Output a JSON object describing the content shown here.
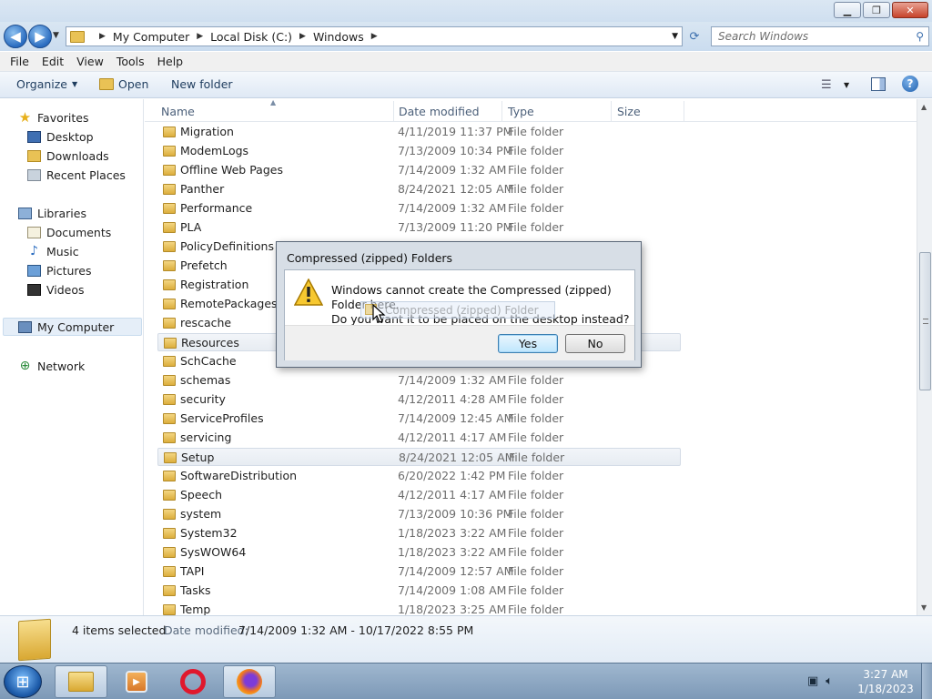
{
  "window": {
    "minimize": "▁",
    "maximize": "❐",
    "close": "✕"
  },
  "address": {
    "back": "◀",
    "forward": "▶",
    "crumbs": [
      "My Computer",
      "Local Disk (C:)",
      "Windows"
    ],
    "search_placeholder": "Search Windows"
  },
  "menu": [
    "File",
    "Edit",
    "View",
    "Tools",
    "Help"
  ],
  "toolbar": {
    "organize": "Organize",
    "open": "Open",
    "new_folder": "New folder",
    "help": "?"
  },
  "nav": {
    "favorites": "Favorites",
    "desktop": "Desktop",
    "downloads": "Downloads",
    "recent": "Recent Places",
    "libraries": "Libraries",
    "documents": "Documents",
    "music": "Music",
    "pictures": "Pictures",
    "videos": "Videos",
    "computer": "My Computer",
    "network": "Network"
  },
  "columns": {
    "name": "Name",
    "date": "Date modified",
    "type": "Type",
    "size": "Size"
  },
  "files": [
    {
      "name": "Migration",
      "date": "4/11/2019 11:37 PM",
      "type": "File folder"
    },
    {
      "name": "ModemLogs",
      "date": "7/13/2009 10:34 PM",
      "type": "File folder"
    },
    {
      "name": "Offline Web Pages",
      "date": "7/14/2009 1:32 AM",
      "type": "File folder"
    },
    {
      "name": "Panther",
      "date": "8/24/2021 12:05 AM",
      "type": "File folder"
    },
    {
      "name": "Performance",
      "date": "7/14/2009 1:32 AM",
      "type": "File folder"
    },
    {
      "name": "PLA",
      "date": "7/13/2009 11:20 PM",
      "type": "File folder"
    },
    {
      "name": "PolicyDefinitions",
      "date": "",
      "type": ""
    },
    {
      "name": "Prefetch",
      "date": "",
      "type": ""
    },
    {
      "name": "Registration",
      "date": "",
      "type": ""
    },
    {
      "name": "RemotePackages",
      "date": "",
      "type": ""
    },
    {
      "name": "rescache",
      "date": "",
      "type": ""
    },
    {
      "name": "Resources",
      "date": "",
      "type": ""
    },
    {
      "name": "SchCache",
      "date": "",
      "type": ""
    },
    {
      "name": "schemas",
      "date": "7/14/2009 1:32 AM",
      "type": "File folder"
    },
    {
      "name": "security",
      "date": "4/12/2011 4:28 AM",
      "type": "File folder"
    },
    {
      "name": "ServiceProfiles",
      "date": "7/14/2009 12:45 AM",
      "type": "File folder"
    },
    {
      "name": "servicing",
      "date": "4/12/2011 4:17 AM",
      "type": "File folder"
    },
    {
      "name": "Setup",
      "date": "8/24/2021 12:05 AM",
      "type": "File folder"
    },
    {
      "name": "SoftwareDistribution",
      "date": "6/20/2022 1:42 PM",
      "type": "File folder"
    },
    {
      "name": "Speech",
      "date": "4/12/2011 4:17 AM",
      "type": "File folder"
    },
    {
      "name": "system",
      "date": "7/13/2009 10:36 PM",
      "type": "File folder"
    },
    {
      "name": "System32",
      "date": "1/18/2023 3:22 AM",
      "type": "File folder"
    },
    {
      "name": "SysWOW64",
      "date": "1/18/2023 3:22 AM",
      "type": "File folder"
    },
    {
      "name": "TAPI",
      "date": "7/14/2009 12:57 AM",
      "type": "File folder"
    },
    {
      "name": "Tasks",
      "date": "7/14/2009 1:08 AM",
      "type": "File folder"
    },
    {
      "name": "Temp",
      "date": "1/18/2023 3:25 AM",
      "type": "File folder"
    }
  ],
  "details": {
    "count": "4 items selected",
    "date_label": "Date modified:",
    "date_value": "7/14/2009 1:32 AM - 10/17/2022 8:55 PM"
  },
  "dialog": {
    "title": "Compressed (zipped) Folders",
    "line1": "Windows cannot create the Compressed (zipped) Folder here.",
    "line2": "Do you want it to be placed on the desktop instead?",
    "yes": "Yes",
    "no": "No"
  },
  "drag_ghost": "Compressed (zipped) Folder",
  "taskbar": {
    "time": "3:27 AM",
    "date": "1/18/2023"
  }
}
